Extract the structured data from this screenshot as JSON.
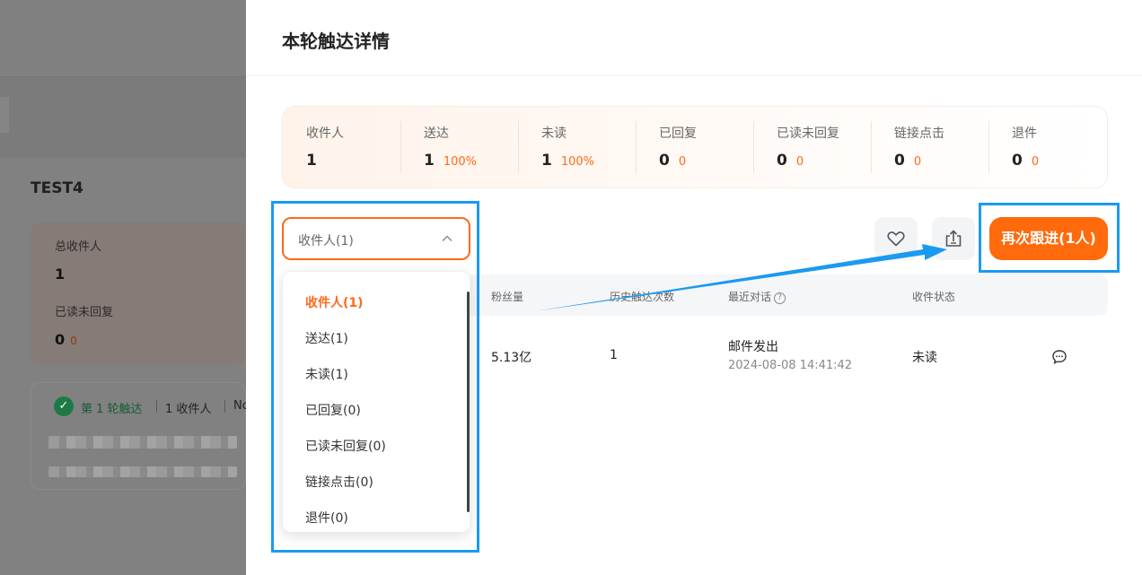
{
  "background": {
    "title": "TEST4",
    "stats": [
      {
        "label": "总收件人",
        "value": "1"
      },
      {
        "label": "已读未回复",
        "value": "0",
        "sub": "0"
      }
    ],
    "round": {
      "label": "第 1 轮触达",
      "recipients": "1 收件人",
      "extra": "No"
    }
  },
  "drawer": {
    "title": "本轮触达详情",
    "stats": [
      {
        "label": "收件人",
        "value": "1",
        "pct": ""
      },
      {
        "label": "送达",
        "value": "1",
        "pct": "100%"
      },
      {
        "label": "未读",
        "value": "1",
        "pct": "100%"
      },
      {
        "label": "已回复",
        "value": "0",
        "pct": "0"
      },
      {
        "label": "已读未回复",
        "value": "0",
        "pct": "0"
      },
      {
        "label": "链接点击",
        "value": "0",
        "pct": "0"
      },
      {
        "label": "退件",
        "value": "0",
        "pct": "0"
      }
    ],
    "filter": {
      "selected": "收件人(1)",
      "options": [
        "收件人(1)",
        "送达(1)",
        "未读(1)",
        "已回复(0)",
        "已读未回复(0)",
        "链接点击(0)",
        "退件(0)"
      ]
    },
    "actions": {
      "favorite_icon": "heart-icon",
      "export_icon": "export-icon",
      "followup_label": "再次跟进(1人)"
    },
    "table": {
      "headers": [
        "粉丝量",
        "历史触达次数",
        "最近对话",
        "收件状态"
      ],
      "row": {
        "fans": "5.13亿",
        "touches": "1",
        "last_dialog": "邮件发出",
        "last_time": "2024-08-08 14:41:42",
        "status": "未读",
        "chat_icon": "chat-icon"
      }
    }
  },
  "colors": {
    "accent": "#ff6a0c",
    "annotation": "#1a9af0"
  }
}
